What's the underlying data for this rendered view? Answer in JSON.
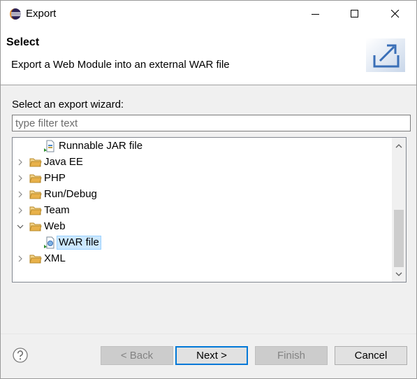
{
  "window": {
    "title": "Export",
    "controls": {
      "minimize": "minimize",
      "maximize": "maximize",
      "close": "close"
    }
  },
  "banner": {
    "title": "Select",
    "description": "Export a Web Module into an external WAR file",
    "image_icon": "export-wizard-icon"
  },
  "wizard": {
    "prompt": "Select an export wizard:",
    "filter": {
      "value": "",
      "placeholder": "type filter text"
    },
    "tree": {
      "items": [
        {
          "label": "Runnable JAR file",
          "icon": "jar-file-icon",
          "level": 1
        },
        {
          "label": "Java EE",
          "icon": "folder-icon",
          "level": 0,
          "state": "collapsed"
        },
        {
          "label": "PHP",
          "icon": "folder-icon",
          "level": 0,
          "state": "collapsed"
        },
        {
          "label": "Run/Debug",
          "icon": "folder-icon",
          "level": 0,
          "state": "collapsed"
        },
        {
          "label": "Team",
          "icon": "folder-icon",
          "level": 0,
          "state": "collapsed"
        },
        {
          "label": "Web",
          "icon": "folder-icon",
          "level": 0,
          "state": "expanded"
        },
        {
          "label": "WAR file",
          "icon": "war-file-icon",
          "level": 1,
          "selected": true
        },
        {
          "label": "XML",
          "icon": "folder-icon",
          "level": 0,
          "state": "collapsed"
        }
      ]
    }
  },
  "footer": {
    "help_icon": "help-icon",
    "back_label": "< Back",
    "next_label": "Next >",
    "finish_label": "Finish",
    "cancel_label": "Cancel"
  },
  "colors": {
    "selection_bg": "#cce8ff",
    "default_button_border": "#0078d7",
    "folder": "#e8b14a"
  }
}
